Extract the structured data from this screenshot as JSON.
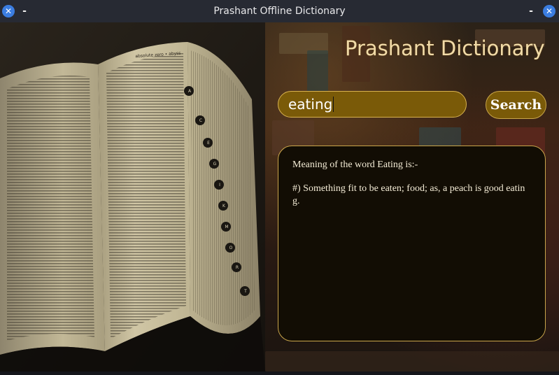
{
  "window": {
    "title": "Prashant Offline Dictionary",
    "close_glyph": "✕",
    "minimize_glyph": "-"
  },
  "app": {
    "brand": "Prashant Dictionary",
    "search_value": "eating",
    "search_button": "Search",
    "meaning_heading": "Meaning of the word Eating is:-",
    "meaning_text": "#) Something fit to be eaten; food; as, a peach is good eating."
  },
  "book_page_header": "absolute zero • abyss",
  "thumb_tabs": [
    "A",
    "C",
    "E",
    "G",
    "I",
    "K",
    "M",
    "O",
    "R",
    "T"
  ],
  "colors": {
    "accent": "#7a5a08",
    "border": "#c9a54a",
    "brand_text": "#f1dba8",
    "box_bg": "#120d04"
  }
}
